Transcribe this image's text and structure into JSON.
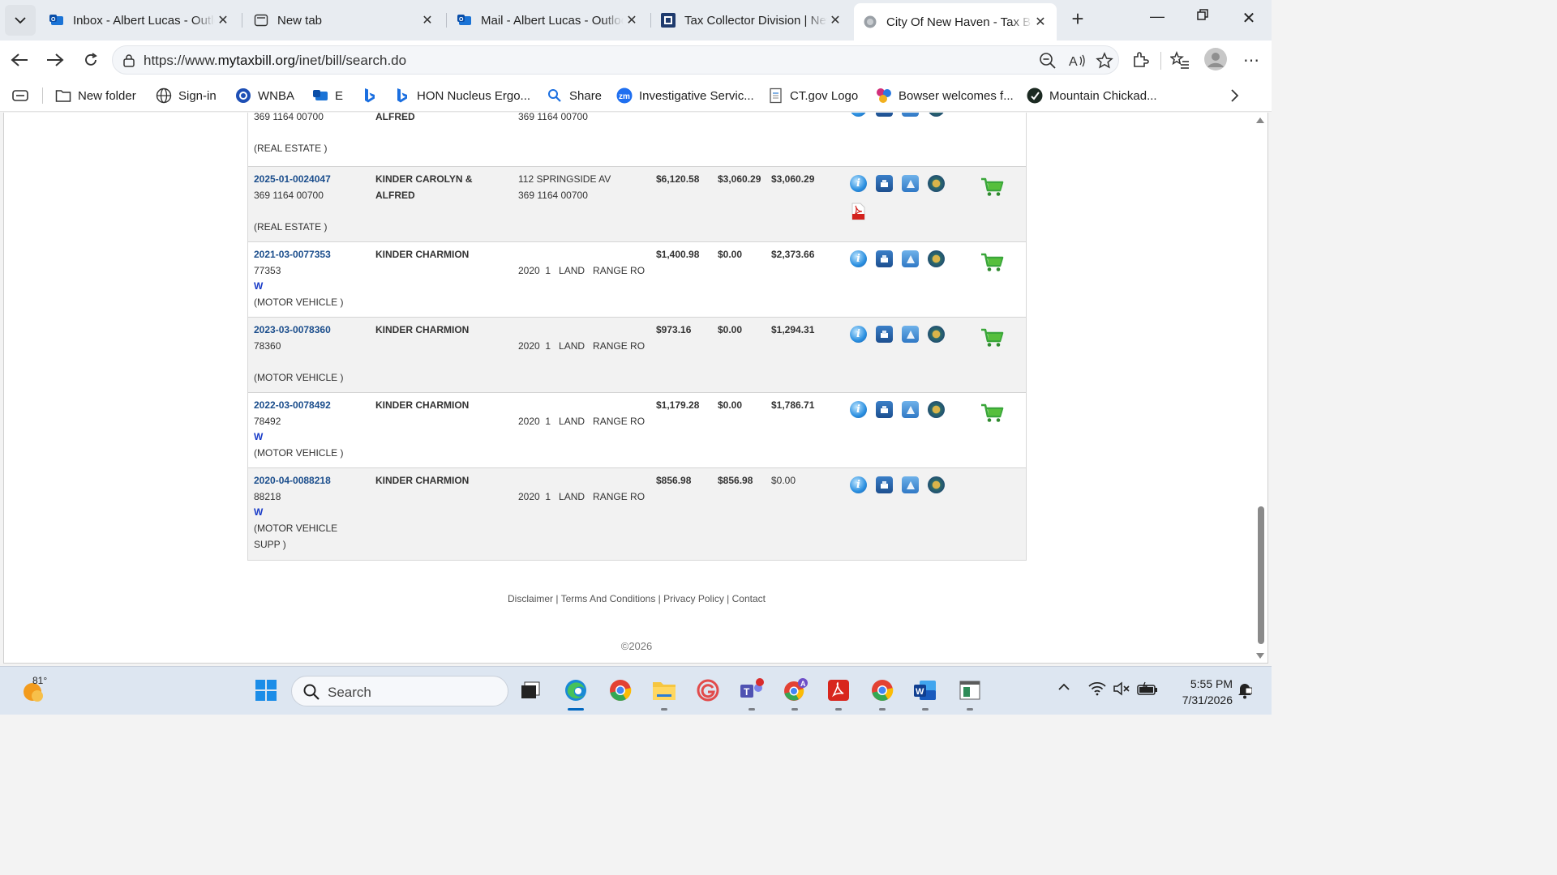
{
  "browser": {
    "tabs": [
      {
        "title": "Inbox - Albert Lucas - Outlook",
        "icon": "outlook-icon"
      },
      {
        "title": "New tab",
        "icon": "newtab-icon"
      },
      {
        "title": "Mail - Albert Lucas - Outlook",
        "icon": "outlook-icon"
      },
      {
        "title": "Tax Collector Division | New Haven",
        "icon": "city-seal-icon"
      },
      {
        "title": "City Of New Haven - Tax Bill",
        "icon": "globe-icon",
        "active": true
      }
    ],
    "url_prefix": "https://www.",
    "url_host": "mytaxbill.org",
    "url_path": "/inet/bill/search.do",
    "favorites": [
      {
        "label": "New folder",
        "icon": "folder-icon"
      },
      {
        "label": "Sign-in",
        "icon": "globe-icon"
      },
      {
        "label": "WNBA",
        "icon": "wnba-icon"
      },
      {
        "label": "E",
        "icon": "outlook-icon"
      },
      {
        "label": "",
        "icon": "bing-icon"
      },
      {
        "label": "HON Nucleus Ergo...",
        "icon": "bing-icon"
      },
      {
        "label": "Share",
        "icon": "search-icon"
      },
      {
        "label": "Investigative Servic...",
        "icon": "zoom-icon"
      },
      {
        "label": "CT.gov Logo",
        "icon": "document-icon"
      },
      {
        "label": "Bowser welcomes f...",
        "icon": "pinwheel-icon"
      },
      {
        "label": "Mountain Chickad...",
        "icon": "bird-icon"
      }
    ]
  },
  "bills": [
    {
      "bill_no": "",
      "sub_id": "369 1164 00700",
      "flag": "",
      "type": "(REAL ESTATE )",
      "owner_line1": "",
      "owner_line2": "ALFRED",
      "property_line1": "",
      "property_line2": "369 1164 00700",
      "original": "",
      "paid": "",
      "balance": "",
      "has_pdf": false,
      "has_cart": false,
      "partial": true
    },
    {
      "bill_no": "2025-01-0024047",
      "sub_id": "369 1164 00700",
      "flag": "",
      "type": "(REAL ESTATE )",
      "owner_line1": "KINDER CAROLYN &",
      "owner_line2": "ALFRED",
      "property_line1": "112  SPRINGSIDE AV",
      "property_line2": "369 1164 00700",
      "original": "$6,120.58",
      "paid": "$3,060.29",
      "balance": "$3,060.29",
      "has_pdf": true,
      "has_cart": true
    },
    {
      "bill_no": "2021-03-0077353",
      "sub_id": "77353",
      "flag": "W",
      "type": "(MOTOR VEHICLE )",
      "owner_line1": "KINDER CHARMION",
      "owner_line2": "",
      "property_line1": "",
      "property_line2": "2020  1   LAND   RANGE RO",
      "original": "$1,400.98",
      "paid": "$0.00",
      "balance": "$2,373.66",
      "has_pdf": false,
      "has_cart": true
    },
    {
      "bill_no": "2023-03-0078360",
      "sub_id": "78360",
      "flag": "",
      "type": "(MOTOR VEHICLE )",
      "owner_line1": "KINDER CHARMION",
      "owner_line2": "",
      "property_line1": "",
      "property_line2": "2020  1   LAND   RANGE RO",
      "original": "$973.16",
      "paid": "$0.00",
      "balance": "$1,294.31",
      "has_pdf": false,
      "has_cart": true
    },
    {
      "bill_no": "2022-03-0078492",
      "sub_id": "78492",
      "flag": "W",
      "type": "(MOTOR VEHICLE )",
      "owner_line1": "KINDER CHARMION",
      "owner_line2": "",
      "property_line1": "",
      "property_line2": "2020  1   LAND   RANGE RO",
      "original": "$1,179.28",
      "paid": "$0.00",
      "balance": "$1,786.71",
      "has_pdf": false,
      "has_cart": true
    },
    {
      "bill_no": "2020-04-0088218",
      "sub_id": "88218",
      "flag": "W",
      "type": "(MOTOR VEHICLE",
      "type_line2": "SUPP )",
      "owner_line1": "KINDER CHARMION",
      "owner_line2": "",
      "property_line1": "",
      "property_line2": "2020  1   LAND   RANGE RO",
      "original": "$856.98",
      "paid": "$856.98",
      "balance": "$0.00",
      "balance_plain": true,
      "has_pdf": false,
      "has_cart": false
    }
  ],
  "footer": {
    "links": [
      "Disclaimer",
      "Terms And Conditions",
      "Privacy Policy",
      "Contact"
    ],
    "separator": " | ",
    "copyright": "©2026"
  },
  "taskbar": {
    "weather_temp": "81°",
    "search_placeholder": "Search",
    "apps": [
      "task-view-icon",
      "edge-icon",
      "chrome-icon",
      "file-explorer-icon",
      "grammarly-icon",
      "teams-icon",
      "chrome-profile-icon",
      "acrobat-icon",
      "chrome-icon",
      "word-icon",
      "notepad-icon"
    ],
    "time": "5:55 PM",
    "date": "7/31/2026"
  },
  "colors": {
    "bill_link": "#1a4d8c",
    "flag": "#1a3cc8",
    "accent": "#0067c0",
    "cart": "#3aa63a"
  }
}
